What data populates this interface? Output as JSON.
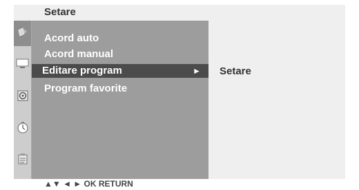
{
  "header": {
    "title": "Setare"
  },
  "sidebar": {
    "icons": [
      {
        "name": "setup-icon",
        "active": true
      },
      {
        "name": "picture-icon",
        "active": false
      },
      {
        "name": "sound-icon",
        "active": false
      },
      {
        "name": "time-icon",
        "active": false
      },
      {
        "name": "options-icon",
        "active": false
      }
    ]
  },
  "menu": {
    "items": [
      {
        "label": "Acord auto"
      },
      {
        "label": "Acord manual"
      },
      {
        "label": "Editare program",
        "selected": true
      },
      {
        "label": "Program favorite"
      }
    ],
    "submenu_arrow": "►"
  },
  "submenu": {
    "label": "Setare"
  },
  "footer": {
    "hint": "▲▼  ◄ ►  OK  RETURN"
  }
}
